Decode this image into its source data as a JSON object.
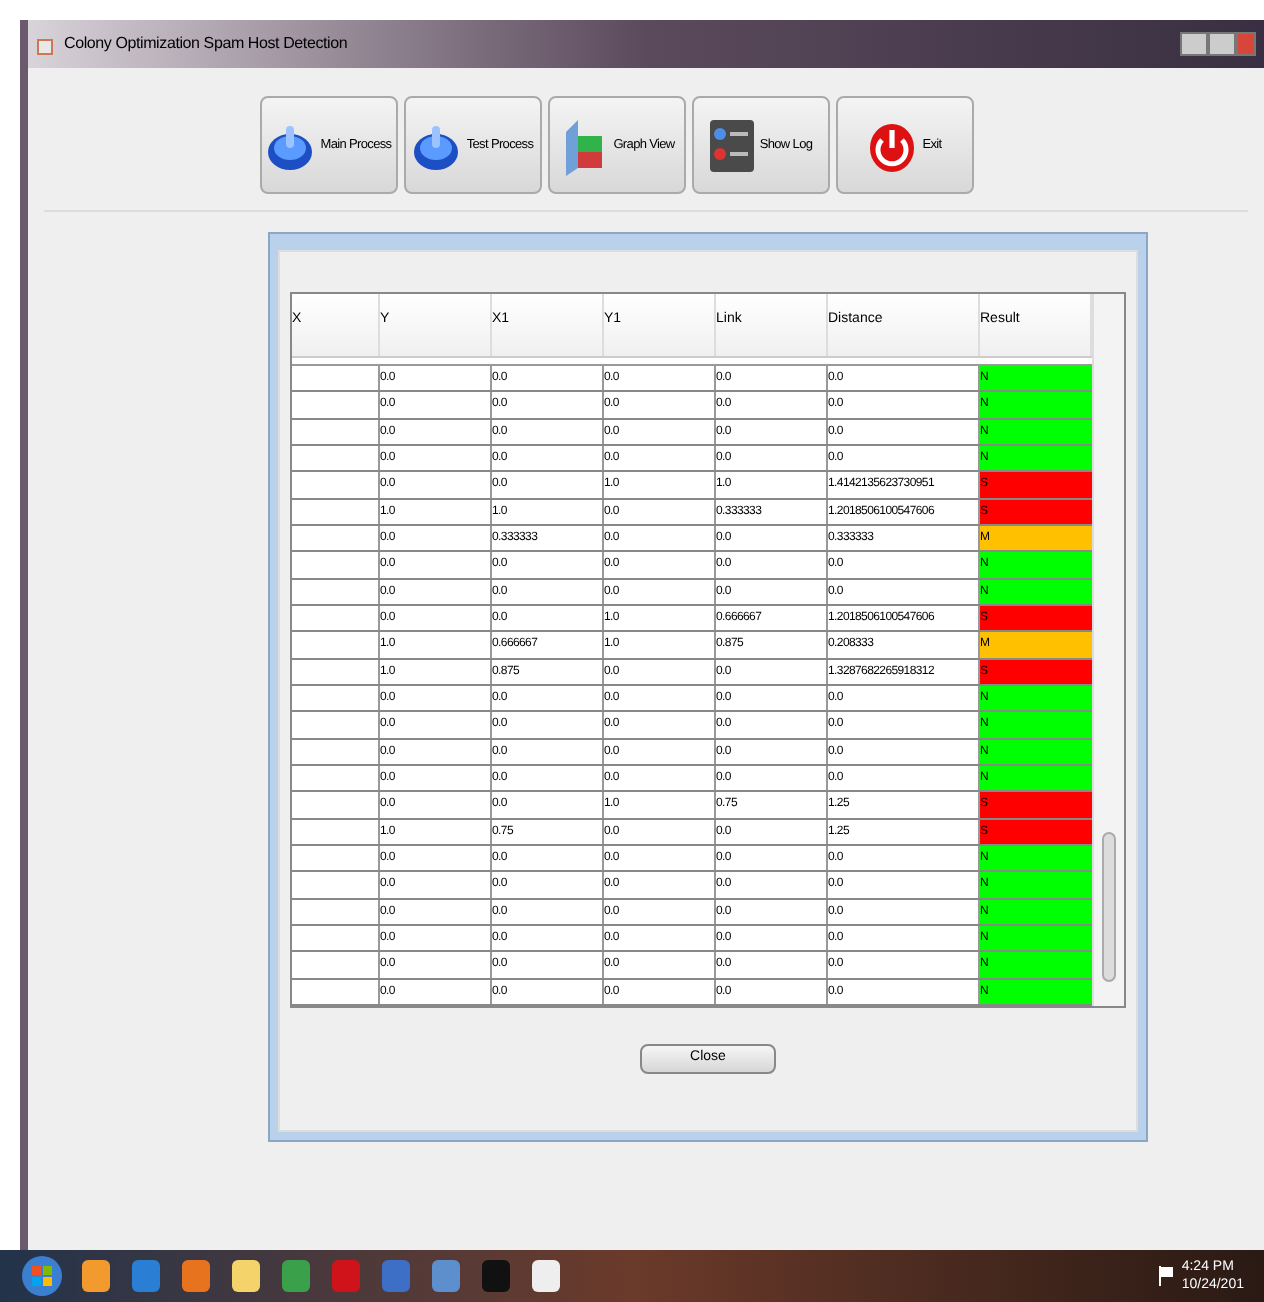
{
  "window": {
    "title": "Colony Optimization Spam Host Detection"
  },
  "toolbar": [
    {
      "label": "Main Process",
      "kind": "power-blue"
    },
    {
      "label": "Test Process",
      "kind": "power-blue"
    },
    {
      "label": "Graph View",
      "kind": "graph"
    },
    {
      "label": "Show Log",
      "kind": "log"
    },
    {
      "label": "Exit",
      "kind": "exit"
    }
  ],
  "table": {
    "columns": [
      "X",
      "Y",
      "X1",
      "Y1",
      "Link",
      "Distance",
      "Result"
    ],
    "rows": [
      {
        "cells": [
          "",
          "0.0",
          "0.0",
          "0.0",
          "0.0",
          "0.0"
        ],
        "result": "N",
        "color": "#00ff00"
      },
      {
        "cells": [
          "",
          "0.0",
          "0.0",
          "0.0",
          "0.0",
          "0.0"
        ],
        "result": "N",
        "color": "#00ff00"
      },
      {
        "cells": [
          "",
          "0.0",
          "0.0",
          "0.0",
          "0.0",
          "0.0"
        ],
        "result": "N",
        "color": "#00ff00"
      },
      {
        "cells": [
          "",
          "0.0",
          "0.0",
          "0.0",
          "0.0",
          "0.0"
        ],
        "result": "N",
        "color": "#00ff00"
      },
      {
        "cells": [
          "",
          "0.0",
          "0.0",
          "1.0",
          "1.0",
          "1.4142135623730951"
        ],
        "result": "S",
        "color": "#ff0000"
      },
      {
        "cells": [
          "",
          "1.0",
          "1.0",
          "0.0",
          "0.333333",
          "1.2018506100547606"
        ],
        "result": "S",
        "color": "#ff0000"
      },
      {
        "cells": [
          "",
          "0.0",
          "0.333333",
          "0.0",
          "0.0",
          "0.333333"
        ],
        "result": "M",
        "color": "#ffc000"
      },
      {
        "cells": [
          "",
          "0.0",
          "0.0",
          "0.0",
          "0.0",
          "0.0"
        ],
        "result": "N",
        "color": "#00ff00"
      },
      {
        "cells": [
          "",
          "0.0",
          "0.0",
          "0.0",
          "0.0",
          "0.0"
        ],
        "result": "N",
        "color": "#00ff00"
      },
      {
        "cells": [
          "",
          "0.0",
          "0.0",
          "1.0",
          "0.666667",
          "1.2018506100547606"
        ],
        "result": "S",
        "color": "#ff0000"
      },
      {
        "cells": [
          "",
          "1.0",
          "0.666667",
          "1.0",
          "0.875",
          "0.208333"
        ],
        "result": "M",
        "color": "#ffc000"
      },
      {
        "cells": [
          "",
          "1.0",
          "0.875",
          "0.0",
          "0.0",
          "1.3287682265918312"
        ],
        "result": "S",
        "color": "#ff0000"
      },
      {
        "cells": [
          "",
          "0.0",
          "0.0",
          "0.0",
          "0.0",
          "0.0"
        ],
        "result": "N",
        "color": "#00ff00"
      },
      {
        "cells": [
          "",
          "0.0",
          "0.0",
          "0.0",
          "0.0",
          "0.0"
        ],
        "result": "N",
        "color": "#00ff00"
      },
      {
        "cells": [
          "",
          "0.0",
          "0.0",
          "0.0",
          "0.0",
          "0.0"
        ],
        "result": "N",
        "color": "#00ff00"
      },
      {
        "cells": [
          "",
          "0.0",
          "0.0",
          "0.0",
          "0.0",
          "0.0"
        ],
        "result": "N",
        "color": "#00ff00"
      },
      {
        "cells": [
          "",
          "0.0",
          "0.0",
          "1.0",
          "0.75",
          "1.25"
        ],
        "result": "S",
        "color": "#ff0000"
      },
      {
        "cells": [
          "",
          "1.0",
          "0.75",
          "0.0",
          "0.0",
          "1.25"
        ],
        "result": "S",
        "color": "#ff0000"
      },
      {
        "cells": [
          "",
          "0.0",
          "0.0",
          "0.0",
          "0.0",
          "0.0"
        ],
        "result": "N",
        "color": "#00ff00"
      },
      {
        "cells": [
          "",
          "0.0",
          "0.0",
          "0.0",
          "0.0",
          "0.0"
        ],
        "result": "N",
        "color": "#00ff00"
      },
      {
        "cells": [
          "",
          "0.0",
          "0.0",
          "0.0",
          "0.0",
          "0.0"
        ],
        "result": "N",
        "color": "#00ff00"
      },
      {
        "cells": [
          "",
          "0.0",
          "0.0",
          "0.0",
          "0.0",
          "0.0"
        ],
        "result": "N",
        "color": "#00ff00"
      },
      {
        "cells": [
          "",
          "0.0",
          "0.0",
          "0.0",
          "0.0",
          "0.0"
        ],
        "result": "N",
        "color": "#00ff00"
      },
      {
        "cells": [
          "",
          "0.0",
          "0.0",
          "0.0",
          "0.0",
          "0.0"
        ],
        "result": "N",
        "color": "#00ff00"
      }
    ]
  },
  "close_button": "Close",
  "taskbar": {
    "time": "4:24 PM",
    "date": "10/24/201"
  }
}
